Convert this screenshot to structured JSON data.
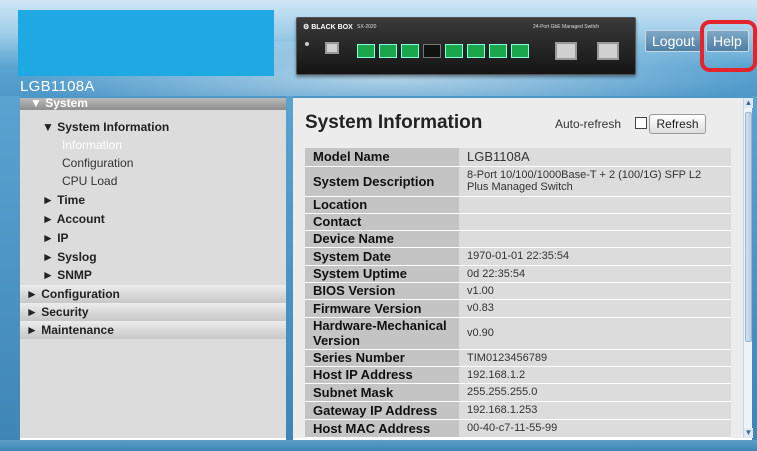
{
  "header": {
    "device_name": "LGB1108A",
    "panel": {
      "brand": "⚙ BLACK BOX",
      "model": "SX-2020",
      "title": "24-Port GbE Managed Switch"
    },
    "logout_label": "Logout",
    "help_label": "Help"
  },
  "sidebar": {
    "system": "▼ System",
    "system_information": "▼ System Information",
    "information": "Information",
    "configuration_sub": "Configuration",
    "cpu_load": "CPU Load",
    "time": "► Time",
    "account": "► Account",
    "ip": "► IP",
    "syslog": "► Syslog",
    "snmp": "► SNMP",
    "configuration": "► Configuration",
    "security": "► Security",
    "maintenance": "► Maintenance"
  },
  "main": {
    "title": "System Information",
    "auto_refresh_label": "Auto-refresh",
    "auto_refresh_checked": false,
    "refresh_label": "Refresh",
    "rows": [
      {
        "key": "Model Name",
        "value": "LGB1108A"
      },
      {
        "key": "System Description",
        "value": "8-Port 10/100/1000Base-T + 2 (100/1G) SFP L2 Plus Managed Switch"
      },
      {
        "key": "Location",
        "value": ""
      },
      {
        "key": "Contact",
        "value": ""
      },
      {
        "key": "Device Name",
        "value": ""
      },
      {
        "key": "System Date",
        "value": "1970-01-01 22:35:54"
      },
      {
        "key": "System Uptime",
        "value": "0d 22:35:54"
      },
      {
        "key": "BIOS Version",
        "value": "v1.00"
      },
      {
        "key": "Firmware Version",
        "value": "v0.83"
      },
      {
        "key": "Hardware-Mechanical Version",
        "value": "v0.90"
      },
      {
        "key": "Series Number",
        "value": "TIM0123456789"
      },
      {
        "key": "Host IP Address",
        "value": "192.168.1.2"
      },
      {
        "key": "Subnet Mask",
        "value": "255.255.255.0"
      },
      {
        "key": "Gateway IP Address",
        "value": "192.168.1.253"
      },
      {
        "key": "Host MAC Address",
        "value": "00-40-c7-11-55-99"
      }
    ]
  },
  "colors": {
    "header_blue": "#4e98c8",
    "logo_blue": "#1ea9e2",
    "highlight_red": "#e5232a",
    "key_cell": "#c4c4c4",
    "value_cell": "#dcdcdc"
  }
}
